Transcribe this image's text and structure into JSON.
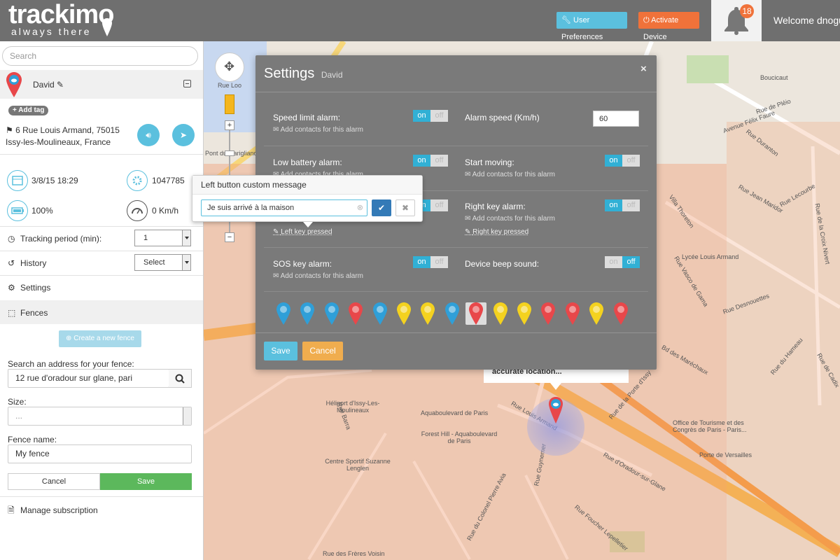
{
  "header": {
    "logo_word": "trackimo",
    "logo_tagline": "always there",
    "user_prefs_label": "User Preferences",
    "activate_device_label": "Activate Device",
    "notification_count": "18",
    "welcome_text": "Welcome dnogu",
    "colors": {
      "bar": "#6f6f6f",
      "prefs": "#5bc0de",
      "activate": "#f0723a"
    }
  },
  "sidebar": {
    "search_placeholder": "Search",
    "device_name": "David",
    "add_tag_label": "+ Add tag",
    "address_line1": "6 Rue Louis Armand, 75015",
    "address_line2": "Issy-les-Moulineaux, France",
    "stats": {
      "datetime": "3/8/15 18:29",
      "device_id": "1047785",
      "battery": "100%",
      "speed": "0 Km/h"
    },
    "tracking_period_label": "Tracking period (min):",
    "tracking_period_value": "1",
    "history_label": "History",
    "history_value": "Select",
    "settings_label": "Settings",
    "fences_label": "Fences",
    "create_fence_label": "Create a new fence",
    "fence_search_label": "Search an address for your fence:",
    "fence_search_value": "12 rue d'oradour sur glane, pari",
    "size_label": "Size:",
    "size_value": "...",
    "fence_name_label": "Fence name:",
    "fence_name_value": "My fence",
    "cancel_label": "Cancel",
    "save_label": "Save",
    "manage_subscription_label": "Manage subscription"
  },
  "map": {
    "labels": [
      "Boucicaut",
      "Avenue Félix Faure",
      "Rue de Pléio",
      "Rue Duranton",
      "Rue Jean Maridor",
      "Rue Lecourbe",
      "Villa Thoreton",
      "Lycée Louis Armand",
      "Rue de la Croix Nivert",
      "Rue Desnouettes",
      "Rue Vasco de Gama",
      "Bd des Maréchaux",
      "Rue du Hameau",
      "Rue de Cadix",
      "Office de Tourisme et des Congrès de Paris - Paris...",
      "Porte de Versailles",
      "Rue de la Porte d'Issy",
      "Rue d'Oradour-sur-Glane",
      "Rue Louis Armand",
      "Héliport d'Issy-Les-Moulineaux",
      "Aquaboulevard de Paris",
      "Forest Hill - Aquaboulevard de Paris",
      "Centre Sportif Suzanne Lenglen",
      "Rue Guynemer",
      "Rue du Colonel Pierre Avia",
      "Rue Foucher Lepelletier",
      "Rue Barra",
      "Rue des Frères Voisin",
      "Pont du Garigliano",
      "Rue Loo"
    ],
    "location_popup": "accurate location..."
  },
  "settings_modal": {
    "title": "Settings",
    "subtitle": "David",
    "close_label": "×",
    "add_contacts_text": "Add contacts for this alarm",
    "toggle_on": "on",
    "toggle_off": "off",
    "speed_limit_label": "Speed limit alarm:",
    "alarm_speed_label": "Alarm speed (Km/h)",
    "alarm_speed_value": "60",
    "low_battery_label": "Low battery alarm:",
    "start_moving_label": "Start moving:",
    "right_key_label": "Right key alarm:",
    "left_key_pressed": "Left key pressed",
    "right_key_pressed": "Right key pressed",
    "sos_key_label": "SOS key alarm:",
    "beep_label": "Device beep sound:",
    "toggles": {
      "speed_limit": "on",
      "low_battery": "on",
      "left_key": "on",
      "start_moving": "on",
      "right_key": "on",
      "sos_key": "on",
      "beep": "off"
    },
    "icons": [
      "globe-pin-icon",
      "paw-pin-icon",
      "leaf-pin-icon",
      "star-pin-icon",
      "flower-pin-icon",
      "walker-pin-icon",
      "chat-pin-icon",
      "car-pin-icon",
      "cloud-pin-icon",
      "target-pin-icon",
      "eye-pin-icon",
      "heart-pin-icon",
      "mustache-pin-icon",
      "key-pin-icon",
      "bulb-pin-icon"
    ],
    "icon_colors": [
      "#2f9fd8",
      "#2f9fd8",
      "#2f9fd8",
      "#e8474a",
      "#2f9fd8",
      "#f4d21f",
      "#f4d21f",
      "#2f9fd8",
      "#e8474a",
      "#f4d21f",
      "#f4d21f",
      "#e8474a",
      "#e8474a",
      "#f4d21f",
      "#e8474a"
    ],
    "selected_icon": "cloud-pin-icon",
    "save_label": "Save",
    "cancel_label": "Cancel"
  },
  "popover": {
    "title": "Left button custom message",
    "input_value": "Je suis arrivé à la maison"
  }
}
